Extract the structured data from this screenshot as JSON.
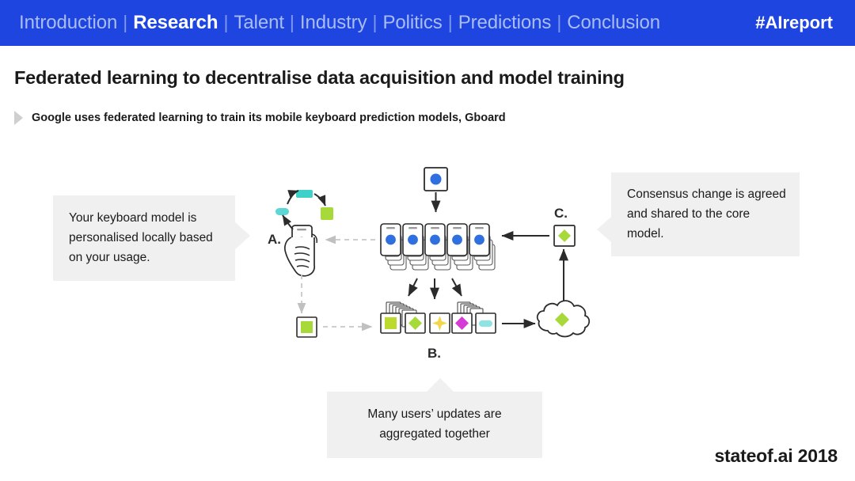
{
  "nav": {
    "items": [
      {
        "label": "Introduction",
        "active": false
      },
      {
        "label": "Research",
        "active": true
      },
      {
        "label": "Talent",
        "active": false
      },
      {
        "label": "Industry",
        "active": false
      },
      {
        "label": "Politics",
        "active": false
      },
      {
        "label": "Predictions",
        "active": false
      },
      {
        "label": "Conclusion",
        "active": false
      }
    ],
    "separator": "|",
    "hashtag": "#AIreport",
    "bg_color": "#1f45e0",
    "active_color": "#ffffff",
    "inactive_color": "#a9bdf4"
  },
  "header": {
    "title": "Federated learning to decentralise data acquisition and model training",
    "subtitle": "Google uses federated learning to train its mobile keyboard prediction models, Gboard",
    "bullet_icon": "triangle-right-icon"
  },
  "callouts": {
    "left": {
      "text": "Your keyboard model is personalised locally based on your usage.",
      "bg_color": "#f0f0f0"
    },
    "right": {
      "text": "Consensus change is agreed and shared to the core model.",
      "bg_color": "#f0f0f0"
    },
    "bottom": {
      "line1": "Many users’ updates are",
      "line2": "aggregated together",
      "bg_color": "#f0f0f0"
    }
  },
  "diagram": {
    "labels": {
      "a": "A.",
      "b": "B.",
      "c": "C."
    },
    "colors": {
      "phone_dot_blue": "#2f6fe0",
      "model_green": "#9fd420",
      "update_teal": "#5fd6d6",
      "update_yellow": "#f2d64b",
      "update_magenta": "#d63bd6",
      "update_cyan": "#8fe3e3",
      "update_green": "#a8d93a",
      "ink": "#2b2b2b",
      "dashed_grey": "#c8c8c8"
    },
    "nodes": {
      "core_model_top": "core-model-card",
      "device_fleet": "phone-stack-row",
      "user_phone": "hand-holding-phone",
      "local_model": "local-model-card",
      "updates_row": "update-card-stacks",
      "cloud": "aggregation-cloud",
      "consensus": "consensus-model-card"
    }
  },
  "footer": {
    "brand": "stateof.ai 2018"
  }
}
